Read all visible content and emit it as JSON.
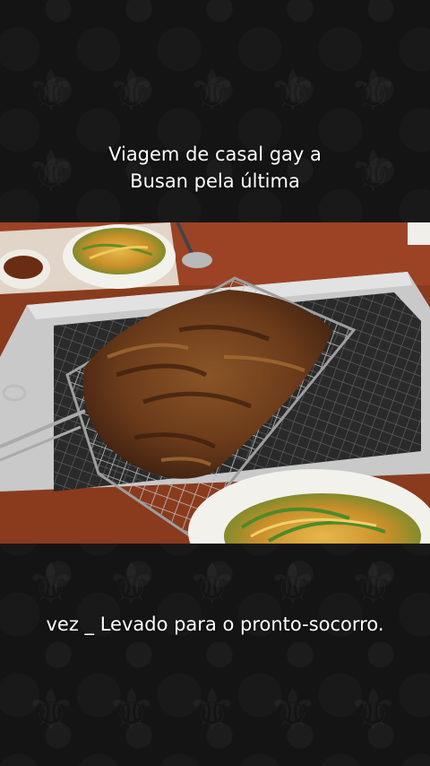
{
  "captions": {
    "top_line1": "Viagem de casal gay a",
    "top_line2": "Busan pela última",
    "bottom": "vez _ Levado para o pronto-socorro."
  },
  "photo": {
    "subject": "korean-bbq-grill-meat",
    "colors": {
      "table": "#8a3b1e",
      "grill_frame": "#c9c9c9",
      "meat": "#6b3b1a",
      "side_dish_bowl": "#f3f1ec",
      "vegetables": "#d9a63a"
    }
  }
}
